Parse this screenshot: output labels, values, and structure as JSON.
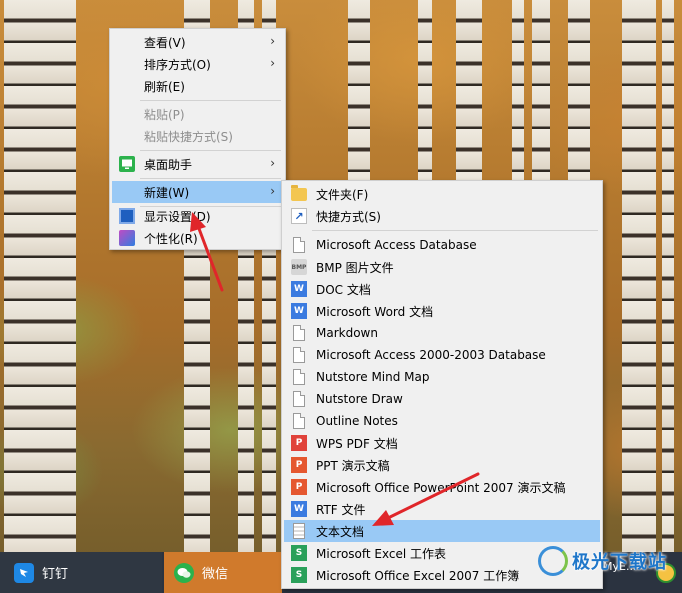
{
  "main_menu": {
    "items": [
      {
        "label": "查看(V)",
        "submenu": true
      },
      {
        "label": "排序方式(O)",
        "submenu": true
      },
      {
        "label": "刷新(E)"
      },
      {
        "label": "粘贴(P)",
        "disabled": true
      },
      {
        "label": "粘贴快捷方式(S)",
        "disabled": true
      },
      {
        "label": "桌面助手",
        "submenu": true,
        "icon": "desktop-assistant-icon"
      },
      {
        "label": "新建(W)",
        "submenu": true,
        "highlighted": true
      },
      {
        "label": "显示设置(D)",
        "icon": "display-settings-icon"
      },
      {
        "label": "个性化(R)",
        "icon": "personalize-icon"
      }
    ],
    "arrow_glyph": "›"
  },
  "new_submenu": {
    "items": [
      {
        "label": "文件夹(F)",
        "icon": "folder-icon"
      },
      {
        "label": "快捷方式(S)",
        "icon": "shortcut-icon"
      },
      {
        "label": "Microsoft Access Database",
        "icon": "blank-file-icon"
      },
      {
        "label": "BMP 图片文件",
        "icon": "bmp-file-icon",
        "icon_text": "BMP"
      },
      {
        "label": "DOC 文档",
        "icon": "word-doc-icon",
        "icon_text": "W"
      },
      {
        "label": "Microsoft Word 文档",
        "icon": "word-doc-icon",
        "icon_text": "W"
      },
      {
        "label": "Markdown",
        "icon": "blank-file-icon"
      },
      {
        "label": "Microsoft Access 2000-2003 Database",
        "icon": "blank-file-icon"
      },
      {
        "label": "Nutstore Mind Map",
        "icon": "blank-file-icon"
      },
      {
        "label": "Nutstore Draw",
        "icon": "blank-file-icon"
      },
      {
        "label": "Outline Notes",
        "icon": "blank-file-icon"
      },
      {
        "label": "WPS PDF 文档",
        "icon": "pdf-icon",
        "icon_text": "P"
      },
      {
        "label": "PPT 演示文稿",
        "icon": "ppt-icon",
        "icon_text": "P"
      },
      {
        "label": "Microsoft Office PowerPoint 2007 演示文稿",
        "icon": "ppt-icon",
        "icon_text": "P"
      },
      {
        "label": "RTF 文件",
        "icon": "word-doc-icon",
        "icon_text": "W"
      },
      {
        "label": "文本文档",
        "icon": "text-file-icon",
        "highlighted": true
      },
      {
        "label": "Microsoft Excel 工作表",
        "icon": "excel-icon",
        "icon_text": "S"
      },
      {
        "label": "Microsoft Office Excel 2007 工作簿",
        "icon": "excel-icon",
        "icon_text": "S"
      }
    ]
  },
  "taskbar": {
    "items": [
      {
        "label": "钉钉",
        "icon": "dingtalk-icon"
      },
      {
        "label": "微信",
        "icon": "wechat-icon"
      }
    ],
    "tail_text": "MyE..."
  },
  "watermark": {
    "text": "极光下载站"
  },
  "colors": {
    "menu_bg": "#f0f0f0",
    "highlight": "#99c9f5",
    "disabled_text": "#8e8e8e",
    "annotation_arrow": "#e0262a"
  }
}
